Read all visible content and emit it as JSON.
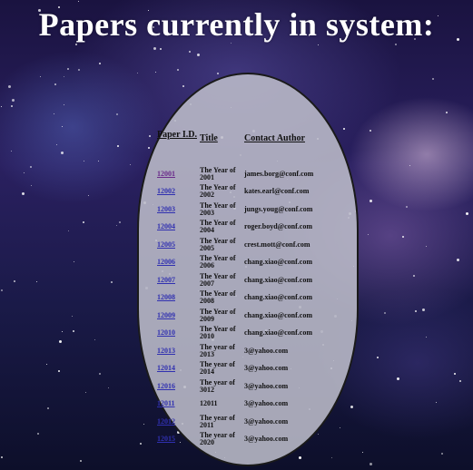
{
  "page": {
    "heading": "Papers currently in system:"
  },
  "table": {
    "headers": {
      "id": "Paper I.D.",
      "title": "Title",
      "author": "Contact Author"
    },
    "rows": [
      {
        "id": "12001",
        "title": "The Year of 2001",
        "author": "james.borg@conf.com"
      },
      {
        "id": "12002",
        "title": "The Year of 2002",
        "author": "kates.earl@conf.com"
      },
      {
        "id": "12003",
        "title": "The Year of 2003",
        "author": "jungs.youg@conf.com"
      },
      {
        "id": "12004",
        "title": "The Year of 2004",
        "author": "roger.boyd@conf.com"
      },
      {
        "id": "12005",
        "title": "The Year of 2005",
        "author": "crest.mott@conf.com"
      },
      {
        "id": "12006",
        "title": "The Year of 2006",
        "author": "chang.xiao@conf.com"
      },
      {
        "id": "12007",
        "title": "The Year of 2007",
        "author": "chang.xiao@conf.com"
      },
      {
        "id": "12008",
        "title": "The Year of 2008",
        "author": "chang.xiao@conf.com"
      },
      {
        "id": "12009",
        "title": "The Year of 2009",
        "author": "chang.xiao@conf.com"
      },
      {
        "id": "12010",
        "title": "The Year of 2010",
        "author": "chang.xiao@conf.com"
      },
      {
        "id": "12013",
        "title": "The year of 2013",
        "author": "3@yahoo.com"
      },
      {
        "id": "12014",
        "title": "The year of 2014",
        "author": "3@yahoo.com"
      },
      {
        "id": "12016",
        "title": "The year of 3012",
        "author": "3@yahoo.com"
      },
      {
        "id": "12011",
        "title": "12011",
        "author": "3@yahoo.com"
      },
      {
        "id": "12012",
        "title": "The year of 2011",
        "author": "3@yahoo.com"
      },
      {
        "id": "12015",
        "title": "The year of 2020",
        "author": "3@yahoo.com"
      }
    ]
  },
  "colors": {
    "link": "#3030b0",
    "visited_link": "#6a2a8a",
    "panel": "#bcbcca"
  }
}
